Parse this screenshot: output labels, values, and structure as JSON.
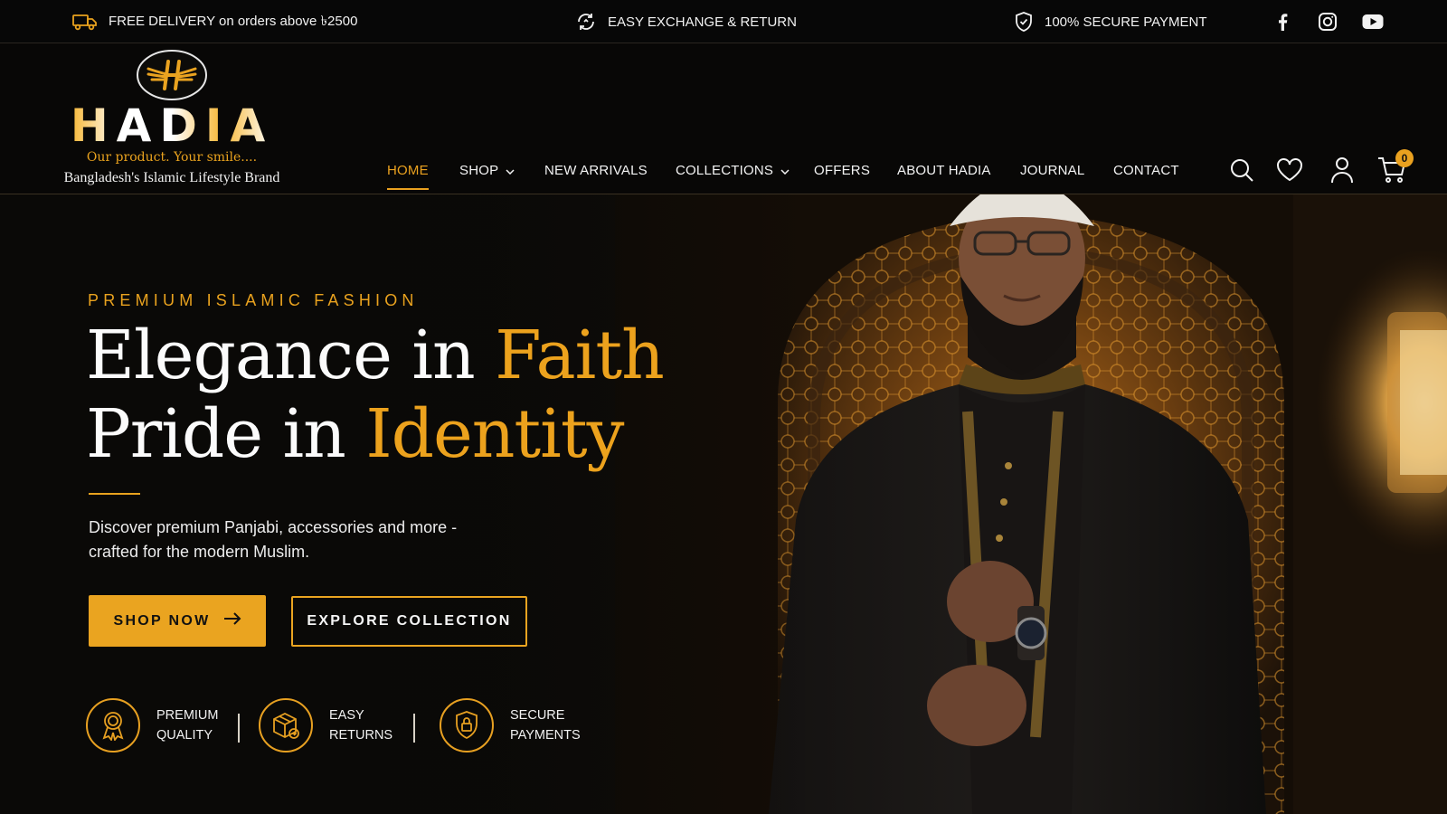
{
  "topbar": {
    "delivery": "FREE DELIVERY on orders above ৳2500",
    "exchange": "EASY EXCHANGE & RETURN",
    "payment": "100% SECURE PAYMENT",
    "social": [
      "facebook-icon",
      "instagram-icon",
      "youtube-icon"
    ]
  },
  "logo": {
    "name": "HADIA",
    "tagline": "Our product. Your smile....",
    "subtitle": "Bangladesh's Islamic Lifestyle Brand"
  },
  "nav": {
    "items": [
      {
        "label": "HOME",
        "active": true
      },
      {
        "label": "SHOP",
        "dropdown": true
      },
      {
        "label": "NEW ARRIVALS"
      },
      {
        "label": "COLLECTIONS",
        "dropdown": true
      },
      {
        "label": "OFFERS"
      },
      {
        "label": "ABOUT HADIA"
      },
      {
        "label": "JOURNAL"
      },
      {
        "label": "CONTACT"
      }
    ],
    "icons": [
      "search-icon",
      "heart-icon",
      "user-icon",
      "cart-icon"
    ],
    "cart_count": "0"
  },
  "hero": {
    "eyebrow": "PREMIUM ISLAMIC FASHION",
    "headline_1_white": "Elegance in ",
    "headline_1_gold": "Faith",
    "headline_2_white": "Pride in ",
    "headline_2_gold": "Identity",
    "description_1": "Discover premium Panjabi, accessories and more -",
    "description_2": "crafted for the modern Muslim.",
    "shop_now": "SHOP NOW",
    "explore": "EXPLORE COLLECTION",
    "features": [
      {
        "icon": "medal-icon",
        "line1": "PREMIUM",
        "line2": "QUALITY"
      },
      {
        "icon": "box-return-icon",
        "line1": "EASY",
        "line2": "RETURNS"
      },
      {
        "icon": "shield-lock-icon",
        "line1": "SECURE",
        "line2": "PAYMENTS"
      }
    ]
  },
  "colors": {
    "accent_gold": "#EAA320",
    "background": "#0B0A08",
    "text": "#FFFFFF"
  }
}
